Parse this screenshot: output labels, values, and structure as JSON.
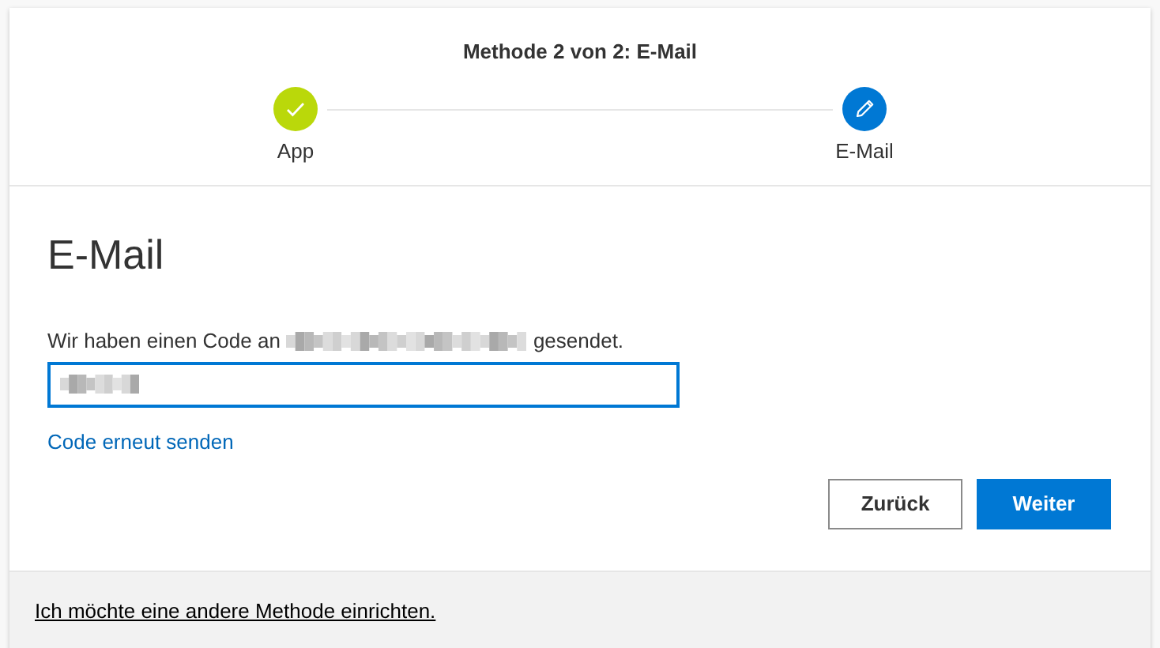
{
  "header": {
    "title": "Methode 2 von 2: E-Mail"
  },
  "steps": [
    {
      "label": "App",
      "kind": "done"
    },
    {
      "label": "E-Mail",
      "kind": "current"
    }
  ],
  "section": {
    "heading": "E-Mail",
    "sentence_start": "Wir haben einen Code an",
    "sentence_end": "gesendet.",
    "resend_link": "Code erneut senden"
  },
  "buttons": [
    {
      "label": "Zurück",
      "kind": "secondary"
    },
    {
      "label": "Weiter",
      "kind": "primary"
    }
  ],
  "footer": {
    "link": "Ich möchte eine andere Methode einrichten."
  }
}
